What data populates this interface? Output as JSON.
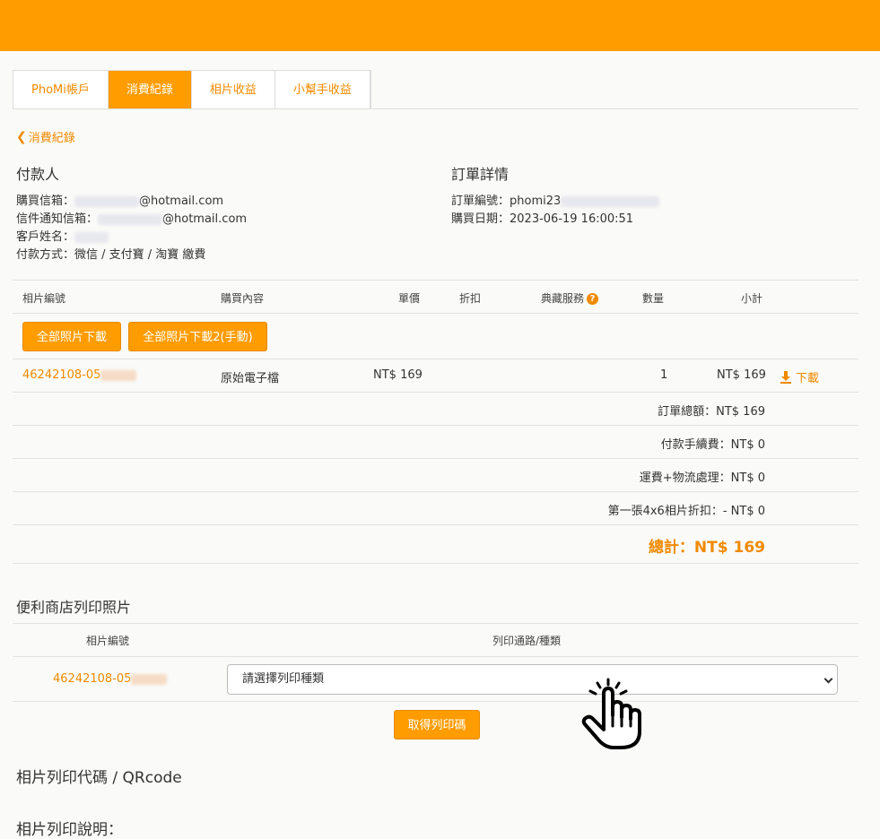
{
  "tabs": [
    {
      "label": "PhoMi帳戶",
      "active": false
    },
    {
      "label": "消費紀錄",
      "active": true
    },
    {
      "label": "相片收益",
      "active": false
    },
    {
      "label": "小幫手收益",
      "active": false
    }
  ],
  "back_link": "消費紀錄",
  "payer": {
    "title": "付款人",
    "purchase_email_label": "購買信箱：",
    "purchase_email_domain": "@hotmail.com",
    "notify_email_label": "信件通知信箱：",
    "notify_email_domain": "@hotmail.com",
    "customer_name_label": "客戶姓名：",
    "payment_method": "付款方式：微信 / 支付寶 / 淘寶 繳費"
  },
  "order": {
    "title": "訂單詳情",
    "order_no_label": "訂單編號：",
    "order_no_prefix": "phomi23",
    "purchase_date": "購買日期：2023-06-19 16:00:51"
  },
  "table": {
    "headers": {
      "photo_id": "相片編號",
      "content": "購買內容",
      "unit_price": "單價",
      "discount": "折扣",
      "collection": "典藏服務",
      "quantity": "數量",
      "subtotal": "小計"
    },
    "buttons": {
      "download_all": "全部照片下載",
      "download_all_manual": "全部照片下載2(手動)"
    },
    "row": {
      "photo_id": "46242108-05",
      "content": "原始電子檔",
      "unit_price": "NT$ 169",
      "quantity": "1",
      "subtotal": "NT$ 169",
      "download": "下載"
    },
    "summary": {
      "order_total": "訂單總額：NT$ 169",
      "payment_fee": "付款手續費：NT$ 0",
      "shipping": "運費+物流處理：NT$ 0",
      "first_discount": "第一張4x6相片折扣：- NT$ 0",
      "grand_total": "總計：NT$ 169"
    }
  },
  "print": {
    "title": "便利商店列印照片",
    "col_photo_id": "相片編號",
    "col_channel": "列印通路/種類",
    "photo_id": "46242108-05",
    "select_placeholder": "請選擇列印種類",
    "get_code_button": "取得列印碼"
  },
  "qr_title": "相片列印代碼 / QRcode",
  "instructions_title": "相片列印說明："
}
